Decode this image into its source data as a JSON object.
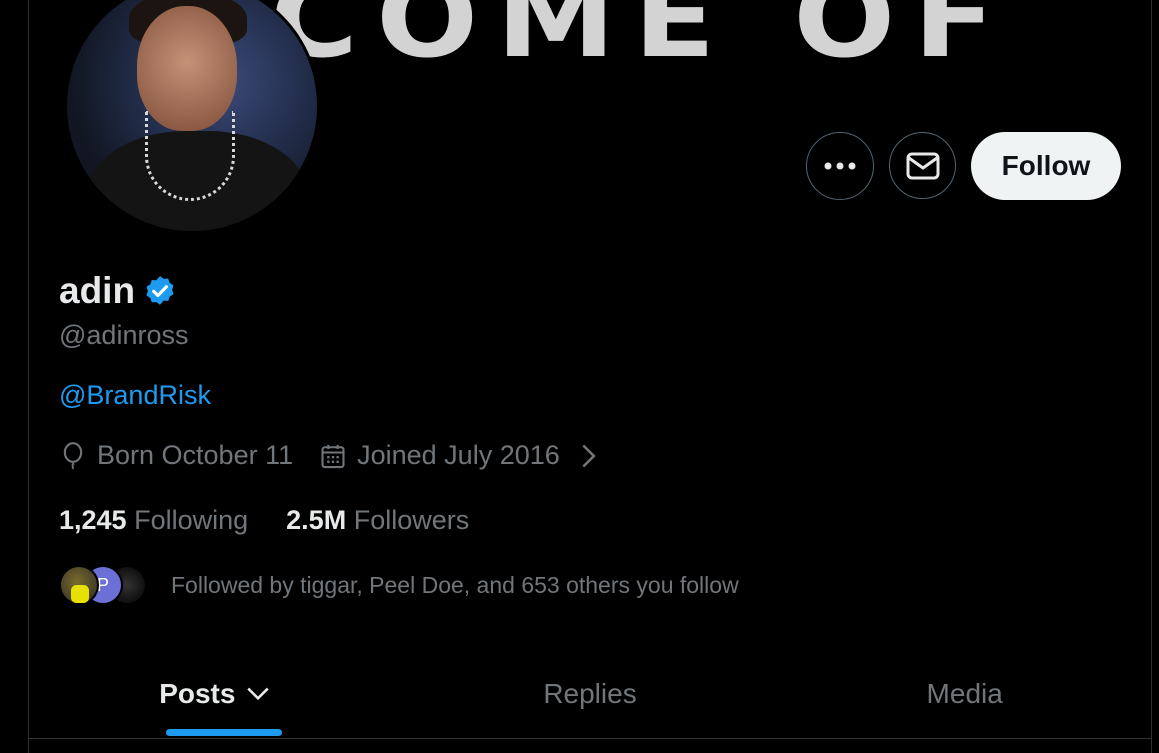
{
  "banner": {
    "text": "COME OF"
  },
  "profile": {
    "name": "adin",
    "handle": "@adinross",
    "bio_link": "@BrandRisk",
    "birth": "Born October 11",
    "joined": "Joined July 2016",
    "following_count": "1,245",
    "following_label": "Following",
    "followers_count": "2.5M",
    "followers_label": "Followers",
    "followed_by": "Followed by tiggar, Peel Doe, and 653 others you follow",
    "mini_avatar_letter": "P"
  },
  "actions": {
    "follow_label": "Follow",
    "more_icon": "more-icon",
    "message_icon": "envelope-icon"
  },
  "tabs": [
    {
      "label": "Posts",
      "active": true
    },
    {
      "label": "Replies",
      "active": false
    },
    {
      "label": "Media",
      "active": false
    }
  ],
  "colors": {
    "accent": "#1d9bf0",
    "muted": "#71767b",
    "text": "#e7e9ea",
    "background": "#000000"
  }
}
